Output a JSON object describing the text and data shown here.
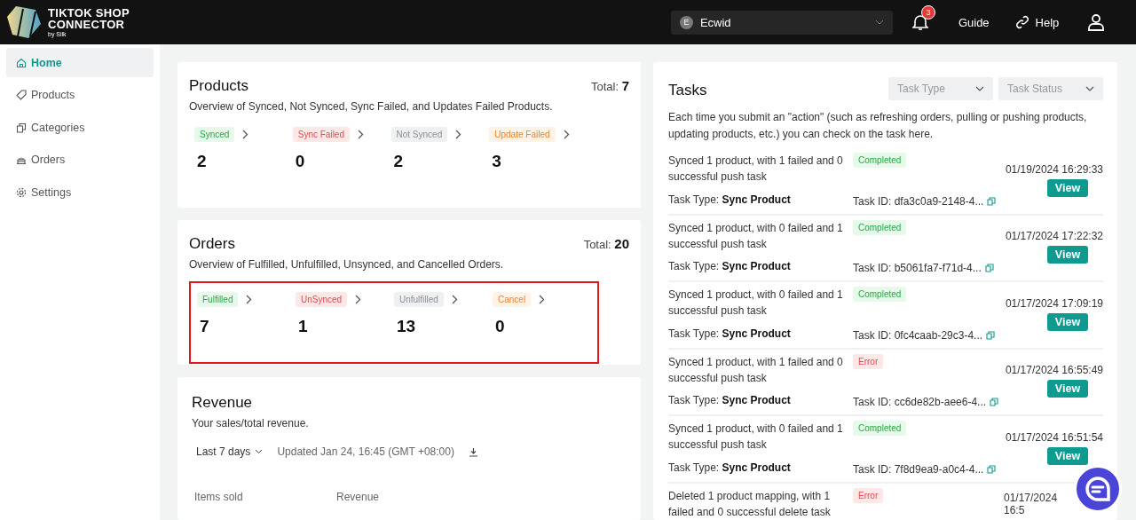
{
  "header": {
    "logo": {
      "line1": "TIKTOK SHOP",
      "line2": "CONNECTOR",
      "byline": "by Silk"
    },
    "store": {
      "initial": "E",
      "name": "Ecwid"
    },
    "notifications": "3",
    "links": [
      "Guide",
      "Help"
    ]
  },
  "sidebar": {
    "items": [
      {
        "label": "Home",
        "selected": true
      },
      {
        "label": "Products",
        "selected": false
      },
      {
        "label": "Categories",
        "selected": false
      },
      {
        "label": "Orders",
        "selected": false
      },
      {
        "label": "Settings",
        "selected": false
      }
    ]
  },
  "products": {
    "title": "Products",
    "total_label": "Total:",
    "total": "7",
    "description": "Overview of Synced, Not Synced, Sync Failed, and Updates Failed Products.",
    "stats": [
      {
        "label": "Synced",
        "kind": "success",
        "value": "2"
      },
      {
        "label": "Sync Failed",
        "kind": "error",
        "value": "0"
      },
      {
        "label": "Not Synced",
        "kind": "neutral",
        "value": "2"
      },
      {
        "label": "Update Failed",
        "kind": "warning",
        "value": "3"
      }
    ]
  },
  "orders": {
    "title": "Orders",
    "total_label": "Total:",
    "total": "20",
    "description": "Overview of Fulfilled, Unfulfilled, Unsynced, and Cancelled Orders.",
    "highlighted": true,
    "stats": [
      {
        "label": "Fulfilled",
        "kind": "success",
        "value": "7"
      },
      {
        "label": "UnSynced",
        "kind": "error",
        "value": "1"
      },
      {
        "label": "Unfulfilled",
        "kind": "neutral",
        "value": "13"
      },
      {
        "label": "Cancel",
        "kind": "warning",
        "value": "0"
      }
    ]
  },
  "revenue": {
    "title": "Revenue",
    "description": "Your sales/total revenue.",
    "range": "Last 7 days",
    "updated": "Updated Jan 24, 16:45 (GMT +08:00)",
    "columns": [
      "Items sold",
      "Revenue"
    ]
  },
  "tasks": {
    "title": "Tasks",
    "filters": [
      {
        "placeholder": "Task Type"
      },
      {
        "placeholder": "Task Status"
      }
    ],
    "description": "Each time you submit an \"action\" (such as refreshing orders, pulling or pushing products, updating products, etc.) you can check on the task here.",
    "rows": [
      {
        "summary": "Synced 1 product, with 1 failed and 0 successful push task",
        "status": "Completed",
        "kind": "completed",
        "type_label": "Task Type:",
        "type": "Sync Product",
        "id": "Task ID: dfa3c0a9-2148-4...",
        "time": "01/19/2024 16:29:33",
        "button": "View"
      },
      {
        "summary": "Synced 1 product, with 0 failed and 1 successful push task",
        "status": "Completed",
        "kind": "completed",
        "type_label": "Task Type:",
        "type": "Sync Product",
        "id": "Task ID: b5061fa7-f71d-4...",
        "time": "01/17/2024 17:22:32",
        "button": "View"
      },
      {
        "summary": "Synced 1 product, with 0 failed and 1 successful push task",
        "status": "Completed",
        "kind": "completed",
        "type_label": "Task Type:",
        "type": "Sync Product",
        "id": "Task ID: 0fc4caab-29c3-4...",
        "time": "01/17/2024 17:09:19",
        "button": "View"
      },
      {
        "summary": "Synced 1 product, with 1 failed and 0 successful push task",
        "status": "Error",
        "kind": "error",
        "type_label": "Task Type:",
        "type": "Sync Product",
        "id": "Task ID: cc6de82b-aee6-4...",
        "time": "01/17/2024 16:55:49",
        "button": "View"
      },
      {
        "summary": "Synced 1 product, with 0 failed and 1 successful push task",
        "status": "Completed",
        "kind": "completed",
        "type_label": "Task Type:",
        "type": "Sync Product",
        "id": "Task ID: 7f8d9ea9-a0c4-4...",
        "time": "01/17/2024 16:51:54",
        "button": "View"
      },
      {
        "summary": "Deleted 1 product mapping, with 1 failed and 0 successful delete task",
        "status": "Error",
        "kind": "error",
        "time": "01/17/2024 16:5"
      }
    ]
  }
}
